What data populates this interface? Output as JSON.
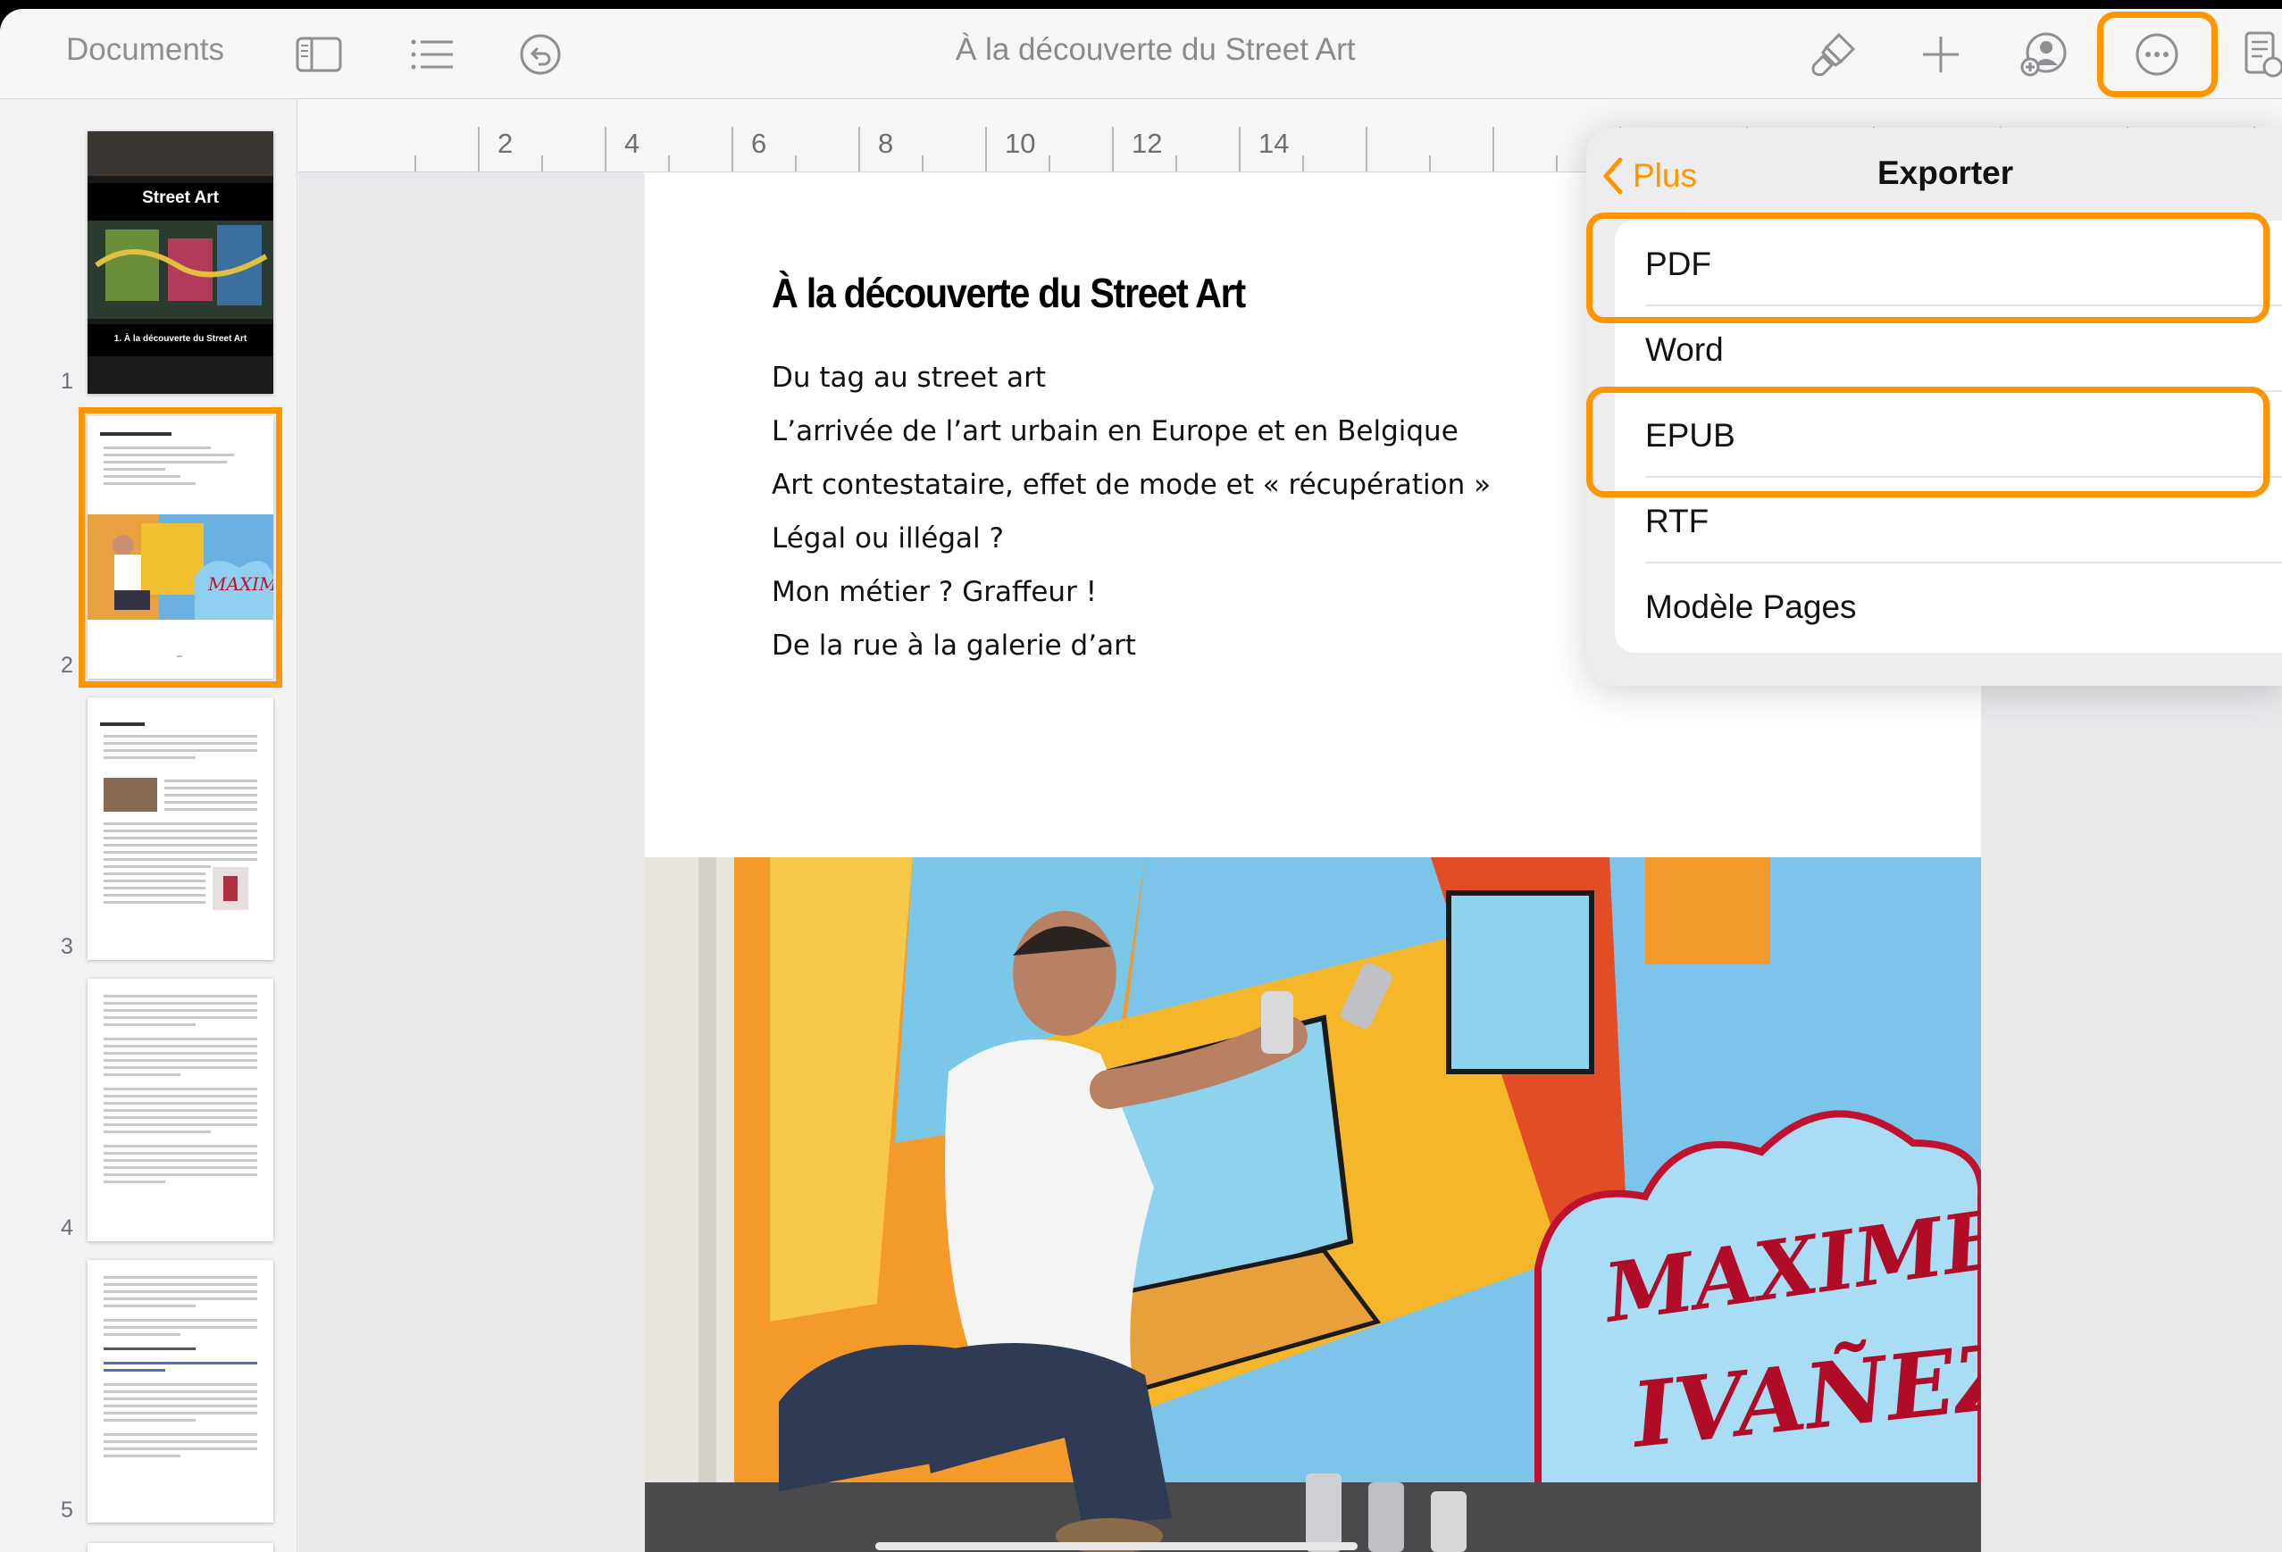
{
  "toolbar": {
    "documents_label": "Documents",
    "title": "À la découverte du Street Art",
    "icons": [
      "sidebar-icon",
      "list-icon",
      "undo-icon",
      "brush-icon",
      "plus-icon",
      "collaborate-icon",
      "more-icon",
      "document-options-icon"
    ]
  },
  "sidebar": {
    "pages": [
      {
        "number": "1",
        "cover_title": "Street Art",
        "cover_subtitle": "1. À la découverte du Street Art"
      },
      {
        "number": "2"
      },
      {
        "number": "3"
      },
      {
        "number": "4"
      },
      {
        "number": "5"
      }
    ]
  },
  "ruler": {
    "labels": [
      "2",
      "4",
      "6",
      "8",
      "10",
      "12",
      "14"
    ]
  },
  "document": {
    "heading": "À la découverte du Street Art",
    "toc": [
      "Du tag au street art",
      "L’arrivée de l’art urbain en Europe et en Belgique",
      "Art contestataire, effet de mode et « récupération »",
      "Légal ou illégal ?",
      "Mon métier ? Graffeur !",
      "De la rue à la galerie d’art"
    ],
    "mural_text_line1": "MAXIME",
    "mural_text_line2": "IVAÑEZ"
  },
  "popover": {
    "back_label": "Plus",
    "title": "Exporter",
    "items": [
      "PDF",
      "Word",
      "EPUB",
      "RTF",
      "Modèle Pages"
    ],
    "highlighted": [
      "PDF",
      "EPUB"
    ]
  },
  "colors": {
    "accent": "#ff9500",
    "toolbar_bg": "#f6f6f7",
    "sidebar_bg": "#f2f2f4"
  }
}
